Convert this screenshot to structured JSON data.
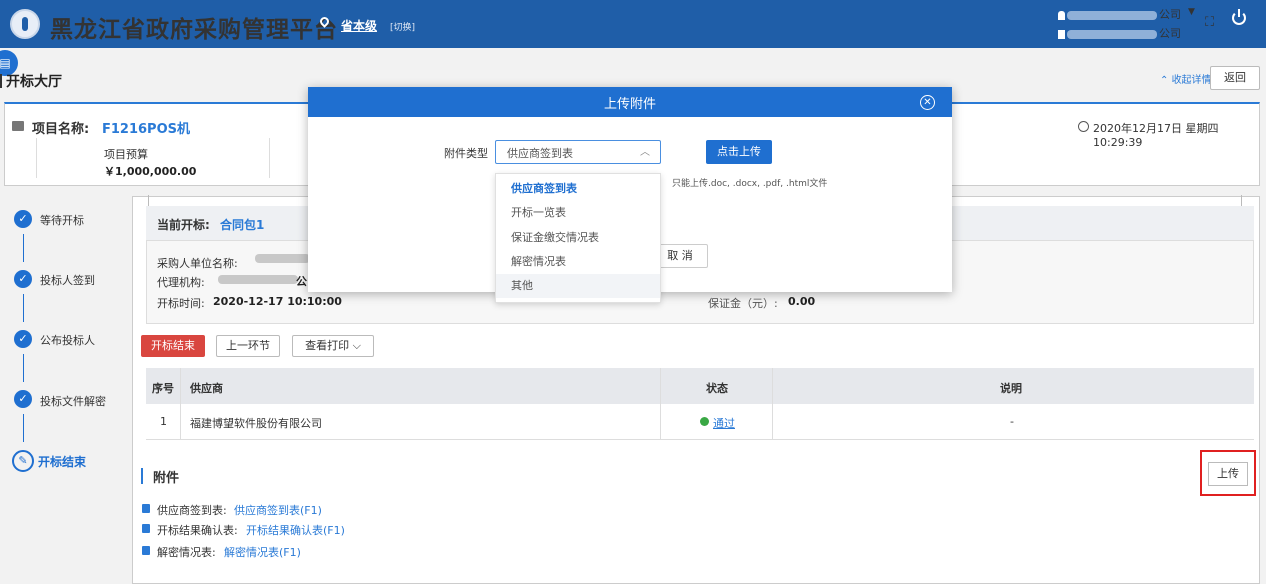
{
  "header": {
    "title": "黑龙江省政府采购管理平台",
    "region": "省本级",
    "region_switch": "[切换]",
    "user_line1_suffix": "公司",
    "user_line2_suffix": "公司"
  },
  "breadcrumb": {
    "title": "开标大厅",
    "collapse_label": "收起详情",
    "back_label": "返回"
  },
  "project": {
    "name_label": "项目名称:",
    "name": "F1216POS机",
    "budget_label": "项目预算",
    "budget_value": "￥1,000,000.00",
    "datetime": "2020年12月17日 星期四 10:29:39"
  },
  "steps": [
    {
      "label": "等待开标"
    },
    {
      "label": "投标人签到"
    },
    {
      "label": "公布投标人"
    },
    {
      "label": "投标文件解密"
    },
    {
      "label": "开标结束"
    }
  ],
  "section": {
    "current_label": "当前开标:",
    "current_value": "合同包1",
    "purchaser_label": "采购人单位名称:",
    "agency_label": "代理机构:",
    "agency_tail": "公",
    "time_label": "开标时间:",
    "time_value": "2020-12-17 10:10:00",
    "deposit_label": "保证金（元）:",
    "deposit_value": "0.00"
  },
  "actions": {
    "end_label": "开标结束",
    "prev_label": "上一环节",
    "print_label": "查看打印"
  },
  "table": {
    "headers": {
      "seq": "序号",
      "supplier": "供应商",
      "status": "状态",
      "note": "说明"
    },
    "rows": [
      {
        "seq": "1",
        "supplier": "福建博望软件股份有限公司",
        "status": "通过",
        "note": "-"
      }
    ]
  },
  "attachments": {
    "title": "附件",
    "upload_label": "上传",
    "items": [
      {
        "label": "供应商签到表:",
        "link": "供应商签到表(F1)"
      },
      {
        "label": "开标结果确认表:",
        "link": "开标结果确认表(F1)"
      },
      {
        "label": "解密情况表:",
        "link": "解密情况表(F1)"
      }
    ]
  },
  "modal": {
    "title": "上传附件",
    "type_label": "附件类型",
    "type_value": "供应商签到表",
    "upload_button": "点击上传",
    "hint": "只能上传.doc, .docx, .pdf, .html文件",
    "cancel_label": "取 消",
    "options": [
      "供应商签到表",
      "开标一览表",
      "保证金缴交情况表",
      "解密情况表",
      "其他"
    ]
  },
  "colors": {
    "header": "#1f5ea8",
    "accent": "#1f6fd0",
    "danger": "#d9463f",
    "success": "#3aa845"
  }
}
